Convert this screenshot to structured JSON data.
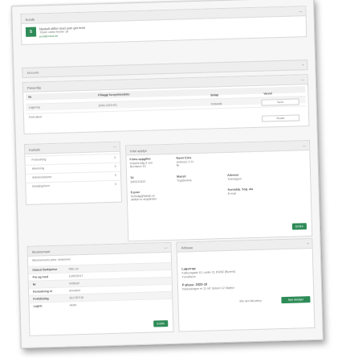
{
  "company": {
    "header_label": "Kunde",
    "name": "Nyskolt stiftet med som gör teori",
    "address": "Trsam vebor fersler 18",
    "email": "post@nvsvk.se",
    "logo_text": "S"
  },
  "section_ann_kunde": {
    "title": "Alt kunde"
  },
  "section_kontakt": {
    "title": "Personlig",
    "col_headers": [
      "Nr",
      "Pålegg/ fornyelsesdato",
      "Beløp",
      "Varsel"
    ],
    "rows": [
      {
        "c1": "Lagerrop",
        "c2": "2040-2323-6/1",
        "c3": "Innbetalt",
        "c4": "Send"
      },
      {
        "c1": "Fortrukkel",
        "c2": "",
        "c3": "",
        "c4": "Bruker"
      }
    ]
  },
  "section_left_list": {
    "title": "Kontakt",
    "items": [
      {
        "label": "Fortsetning",
        "count": "0"
      },
      {
        "label": "Abonning",
        "count": "0"
      },
      {
        "label": "Administratorer",
        "count": "0"
      },
      {
        "label": "Betalingsform",
        "count": "0"
      }
    ]
  },
  "section_info": {
    "title": "Info/ opplys",
    "fields": [
      {
        "label": "Firma oppgifter",
        "lines": [
          "Innbehl tdig 0 veir",
          "Nordsturt 10"
        ]
      },
      {
        "label": "Navn/ Eien.",
        "lines": [
          "Underpo 3 11",
          "Nr"
        ]
      },
      {
        "label": "Tlf",
        "lines": [
          "2002/12423"
        ]
      },
      {
        "label": "E-post",
        "lines": [
          "Svfnslig@fabab.se",
          "wtdtsh in skapfimiler"
        ]
      },
      {
        "label": "Manstr",
        "lines": [
          "Trygdesleie"
        ]
      },
      {
        "label": "Adresse",
        "lines": [
          "Trsh/elgom"
        ]
      },
      {
        "label": "Kontaktp. Sog. ata",
        "lines": [
          "E-mail"
        ]
      }
    ],
    "button": "Endre"
  },
  "section_bank": {
    "title": "Abonnement",
    "subtitle": "Abonnements plan: Innlarmen",
    "rows": [
      {
        "k": "Status/ Budsjettor",
        "v": "Aktiv av"
      },
      {
        "k": "Fra og med",
        "v": "15/05/2017"
      },
      {
        "k": "Nr",
        "v": "Innbetal"
      },
      {
        "k": "Fortsetning er",
        "v": "Annullert"
      },
      {
        "k": "Forfallsdag",
        "v": "2017/07/10"
      },
      {
        "k": "Lagret",
        "v": "Aktivt"
      }
    ],
    "button": "Endre"
  },
  "section_adresse": {
    "title": "Adresse",
    "heading": "Lagerrop",
    "line1": "Fakturagade 10, under 21 83282 (Bysent)",
    "line2": "Trondheim",
    "heading2": "P-plass: 2023-10",
    "line3": "Fakturaingen nr 11 ref: dalsen 12 Opplys",
    "link": "Ble den lab jobsy",
    "button": "Nye detaljer"
  }
}
